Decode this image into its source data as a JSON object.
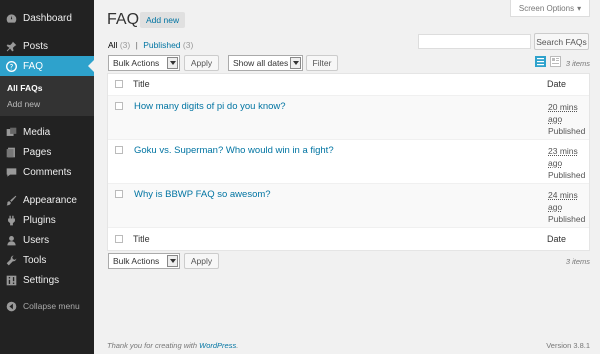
{
  "sidebar": {
    "items": [
      {
        "label": "Dashboard",
        "icon": "dashboard-icon"
      },
      {
        "label": "Posts",
        "icon": "pin-icon"
      },
      {
        "label": "FAQ",
        "icon": "question-icon"
      },
      {
        "label": "Media",
        "icon": "media-icon"
      },
      {
        "label": "Pages",
        "icon": "pages-icon"
      },
      {
        "label": "Comments",
        "icon": "comments-icon"
      },
      {
        "label": "Appearance",
        "icon": "brush-icon"
      },
      {
        "label": "Plugins",
        "icon": "plugin-icon"
      },
      {
        "label": "Users",
        "icon": "users-icon"
      },
      {
        "label": "Tools",
        "icon": "wrench-icon"
      },
      {
        "label": "Settings",
        "icon": "settings-icon"
      },
      {
        "label": "Collapse menu",
        "icon": "collapse-icon"
      }
    ],
    "submenu": [
      {
        "label": "All FAQs"
      },
      {
        "label": "Add new"
      }
    ],
    "accent": "#2ea2cc"
  },
  "header": {
    "title": "FAQ",
    "add_new": "Add new",
    "screen_options": "Screen Options"
  },
  "filters": {
    "all_label": "All",
    "all_count": "(3)",
    "separator": "|",
    "published_label": "Published",
    "published_count": "(3)"
  },
  "search": {
    "value": "",
    "button": "Search FAQs"
  },
  "toolbar": {
    "bulk_actions": "Bulk Actions",
    "apply": "Apply",
    "dates": "Show all dates",
    "filter": "Filter",
    "items_count": "3 items"
  },
  "table": {
    "columns": {
      "title": "Title",
      "date": "Date"
    },
    "rows": [
      {
        "title": "How many digits of pi do you know?",
        "ago_1": "20 mins",
        "ago_2": "ago",
        "status": "Published"
      },
      {
        "title": "Goku vs. Superman? Who would win in a fight?",
        "ago_1": "23 mins",
        "ago_2": "ago",
        "status": "Published"
      },
      {
        "title": "Why is BBWP FAQ so awesom?",
        "ago_1": "24 mins",
        "ago_2": "ago",
        "status": "Published"
      }
    ]
  },
  "footer": {
    "thanks": "Thank you for creating with",
    "wordpress": "WordPress",
    "period": ".",
    "version": "Version 3.8.1"
  }
}
